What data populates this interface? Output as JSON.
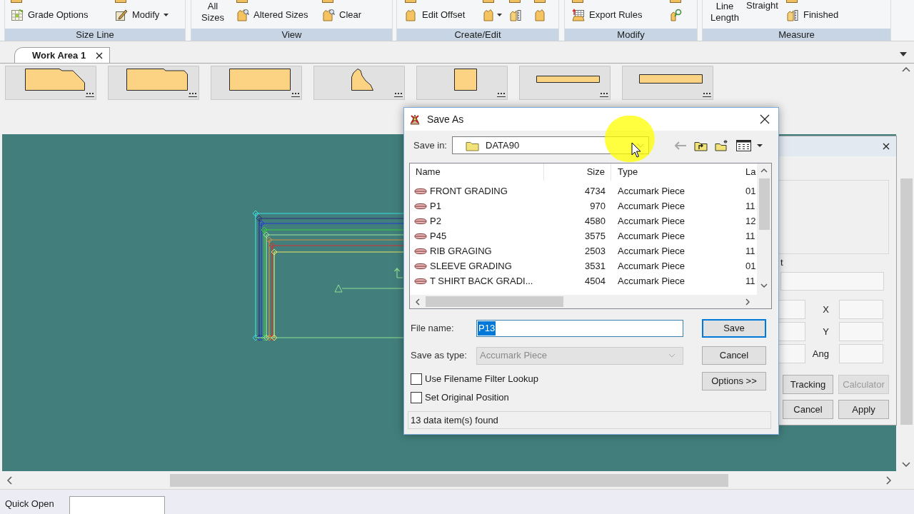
{
  "ribbon": {
    "groups": [
      {
        "label": "Size Line",
        "items": [
          {
            "kind": "small",
            "label": "Grade Options"
          },
          {
            "kind": "small",
            "label": "Modify",
            "menu": true
          }
        ]
      },
      {
        "label": "View",
        "items": [
          {
            "kind": "large",
            "label": "All Sizes"
          },
          {
            "kind": "small",
            "label": "Altered Sizes"
          },
          {
            "kind": "small",
            "label": "Clear"
          }
        ]
      },
      {
        "label": "Create/Edit",
        "items": [
          {
            "kind": "small",
            "label": "Edit Offset"
          },
          {
            "kind": "icon",
            "menu": true
          },
          {
            "kind": "icon"
          },
          {
            "kind": "icon"
          }
        ]
      },
      {
        "label": "Modify",
        "items": [
          {
            "kind": "small",
            "label": "Export Rules"
          },
          {
            "kind": "icon"
          }
        ]
      },
      {
        "label": "Measure",
        "items": [
          {
            "kind": "large",
            "label": "Line Length"
          },
          {
            "kind": "top",
            "label": "Straight"
          },
          {
            "kind": "small",
            "label": "Finished"
          }
        ]
      }
    ]
  },
  "tabs": [
    {
      "label": "Work Area 1",
      "selected": true
    }
  ],
  "tool_panel": {
    "group_label": "t",
    "coordinates": [
      {
        "label": "X"
      },
      {
        "label": "Y"
      },
      {
        "label": "Ang"
      }
    ],
    "buttons": [
      {
        "label": "Tracking",
        "disabled": false
      },
      {
        "label": "Calculator",
        "disabled": true
      },
      {
        "label": "Cancel",
        "disabled": false
      },
      {
        "label": "Apply",
        "disabled": false
      }
    ]
  },
  "save_as_dialog": {
    "title": "Save As",
    "save_in": {
      "label": "Save in:",
      "value": "DATA90"
    },
    "file_list": {
      "columns": [
        "Name",
        "Size",
        "Type",
        "La"
      ],
      "rows": [
        {
          "cells": [
            "FRONT GRADING",
            "4734",
            "Accumark Piece",
            "01"
          ]
        },
        {
          "cells": [
            "P1",
            "970",
            "Accumark Piece",
            "11"
          ]
        },
        {
          "cells": [
            "P2",
            "4580",
            "Accumark Piece",
            "12"
          ]
        },
        {
          "cells": [
            "P45",
            "3575",
            "Accumark Piece",
            "11"
          ]
        },
        {
          "cells": [
            "RIB GRAGING",
            "2503",
            "Accumark Piece",
            "11"
          ]
        },
        {
          "cells": [
            "SLEEVE GRADING",
            "3531",
            "Accumark Piece",
            "01"
          ]
        },
        {
          "cells": [
            "T SHIRT BACK GRADI...",
            "4504",
            "Accumark Piece",
            "11"
          ]
        }
      ]
    },
    "file_name": {
      "label": "File name:",
      "value": "P13",
      "selected": true
    },
    "save_as_type": {
      "label": "Save as type:",
      "value": "Accumark Piece",
      "disabled": true
    },
    "buttons": [
      {
        "label": "Save",
        "default": true
      },
      {
        "label": "Cancel",
        "default": false
      },
      {
        "label": "Options >>",
        "default": false
      }
    ],
    "checkboxes": [
      {
        "label": "Use Filename Filter Lookup",
        "checked": false
      },
      {
        "label": "Set Original Position",
        "checked": false
      }
    ],
    "status": "13 data item(s) found"
  },
  "quick_open": {
    "label": "Quick Open"
  }
}
